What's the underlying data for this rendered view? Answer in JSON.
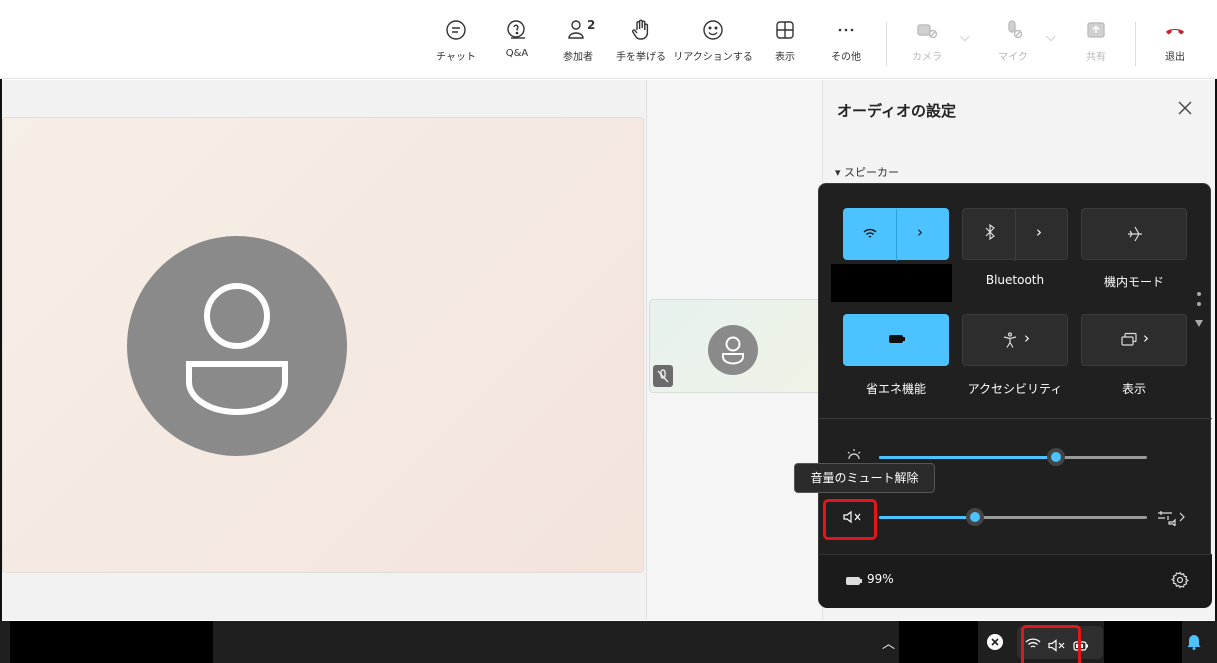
{
  "toolbar": {
    "chat_label": "チャット",
    "qa_label": "Q&A",
    "participants_label": "参加者",
    "participants_count": "2",
    "raise_hand_label": "手を挙げる",
    "reactions_label": "リアクションする",
    "view_label": "表示",
    "more_label": "その他",
    "camera_label": "カメラ",
    "mic_label": "マイク",
    "share_label": "共有",
    "leave_label": "退出"
  },
  "audio_panel": {
    "title": "オーディオの設定",
    "speaker_section": "▾ スピーカー"
  },
  "quick_settings": {
    "bluetooth_label": "Bluetooth",
    "airplane_label": "機内モード",
    "battery_saver_label": "省エネ機能",
    "accessibility_label": "アクセシビリティ",
    "display_label": "表示",
    "brightness_level": 0.66,
    "volume_level": 0.36,
    "volume_muted": true,
    "battery_text": "99%",
    "accent_color": "#4cc2ff"
  },
  "tooltip": {
    "text": "音量のミュート解除"
  },
  "colors": {
    "leave_red": "#c4262e",
    "highlight_red": "#e3161b"
  }
}
